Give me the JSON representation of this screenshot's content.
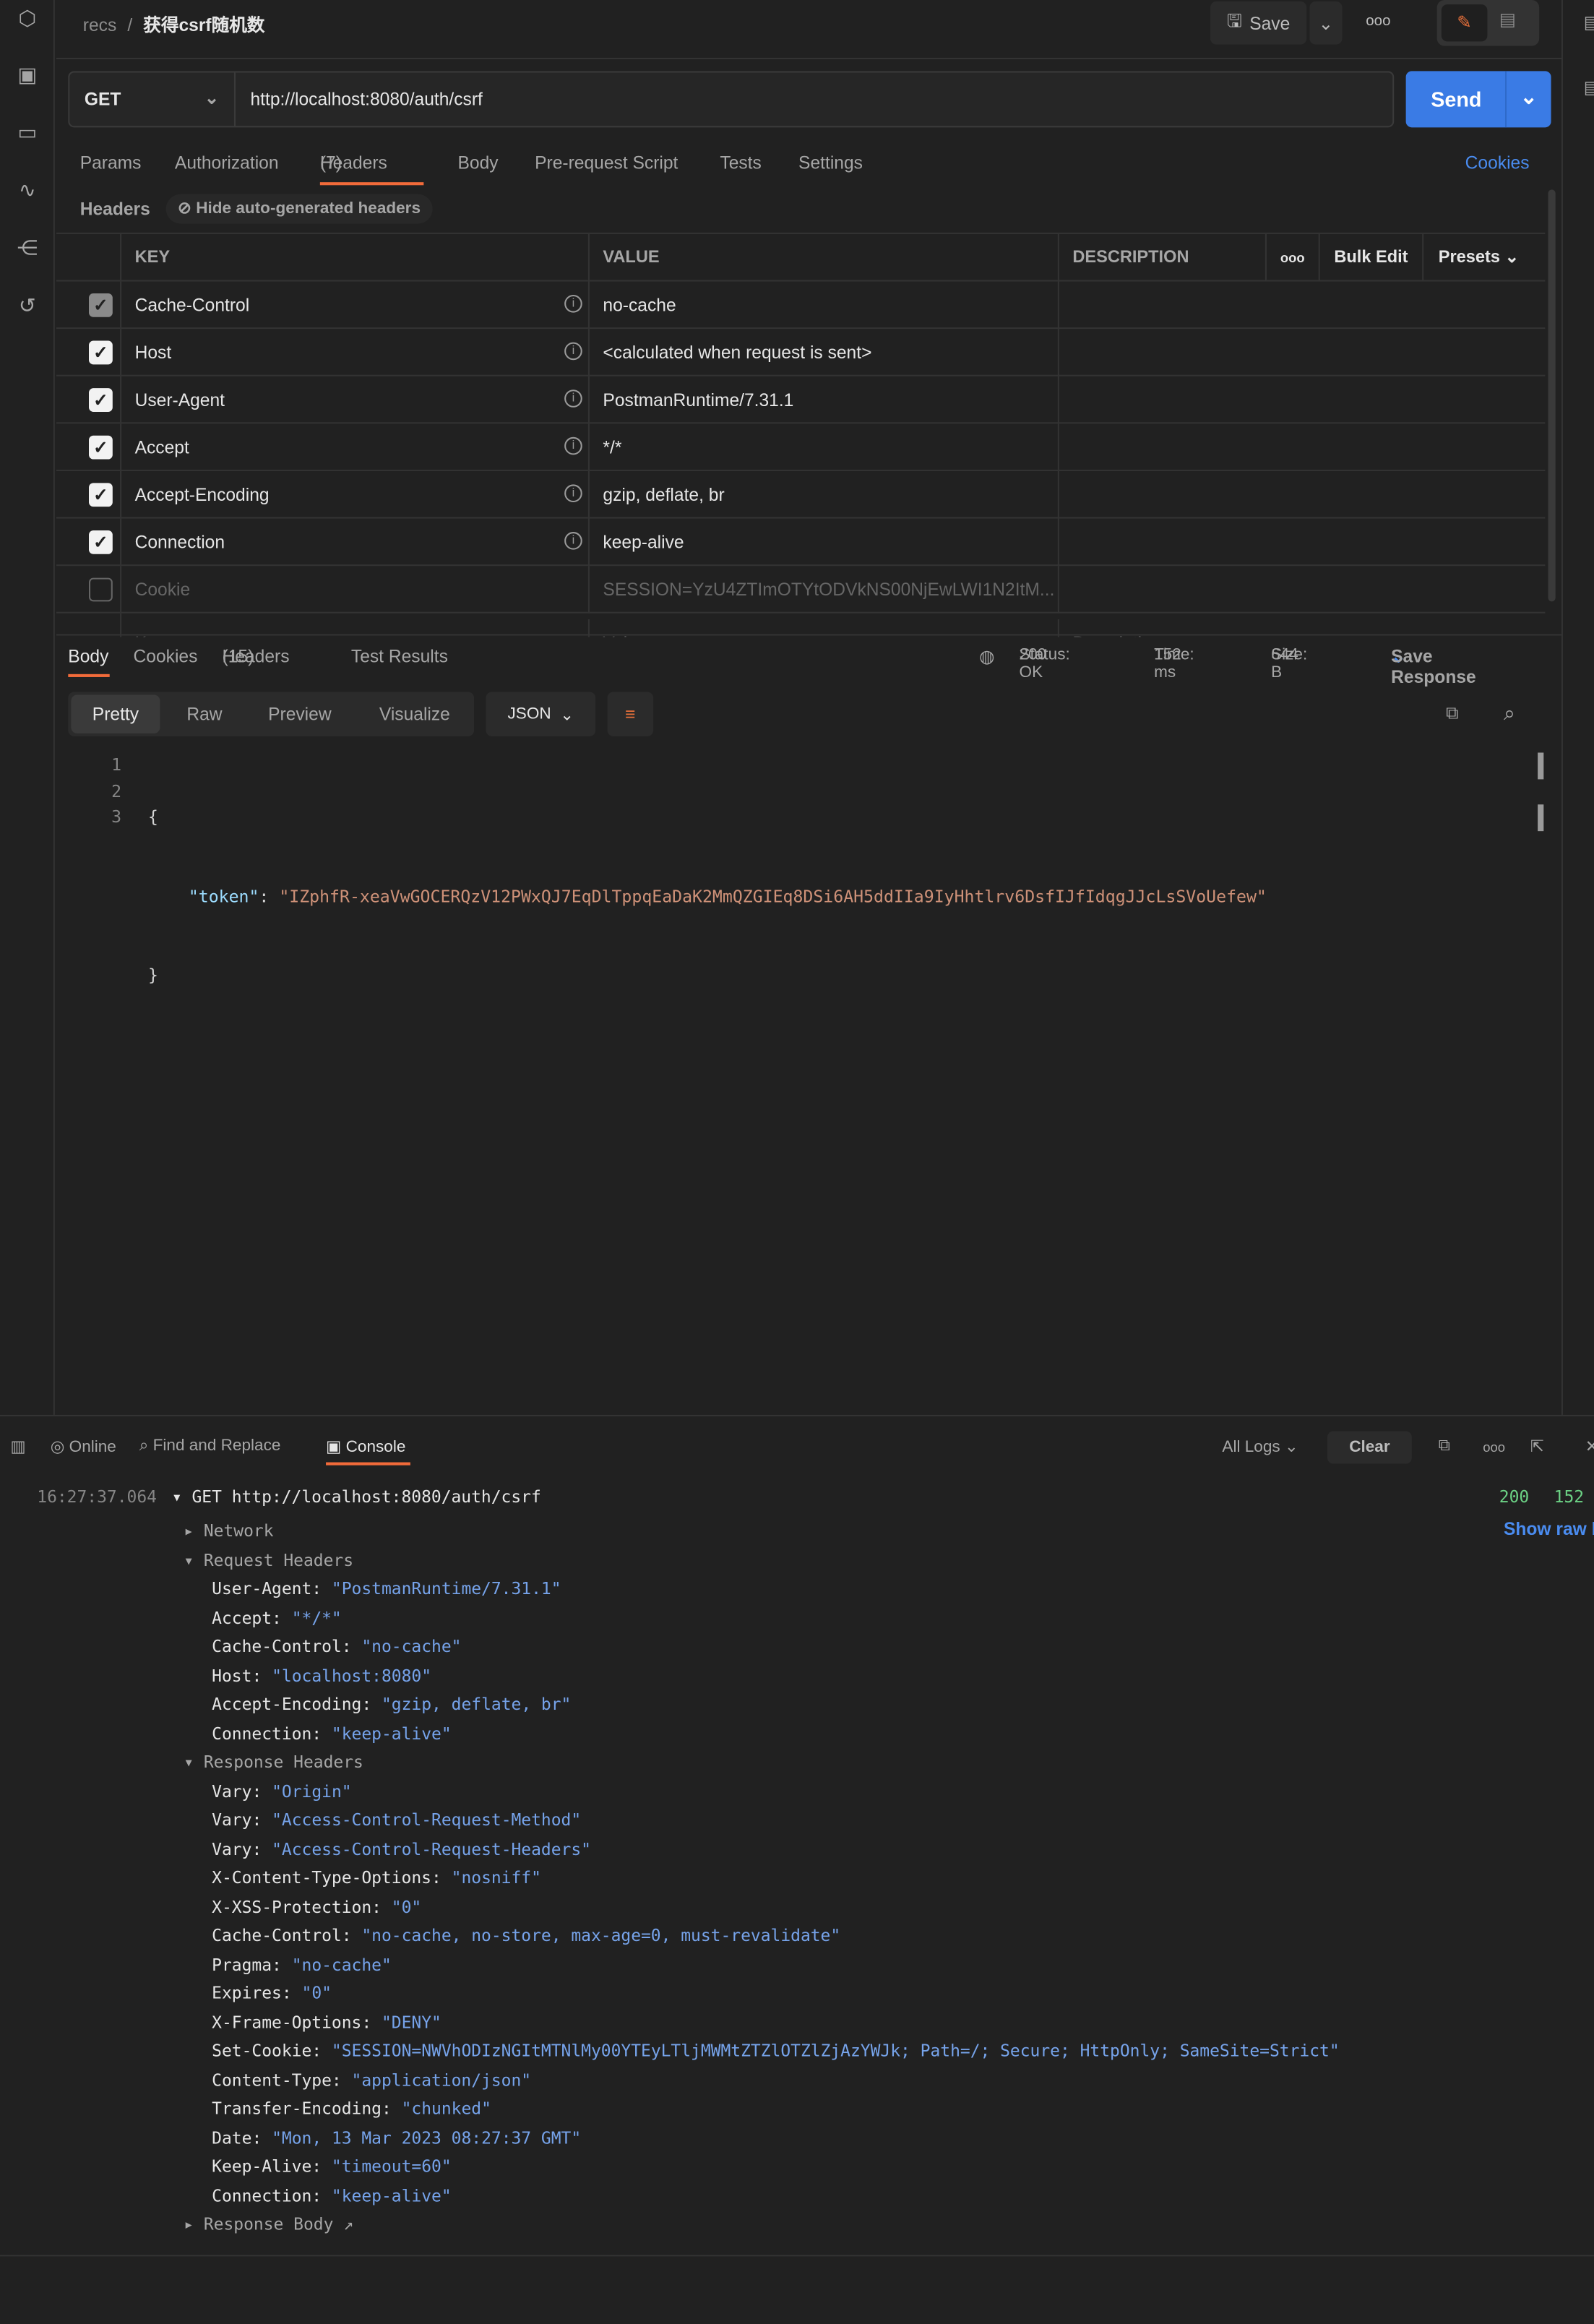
{
  "breadcrumb": {
    "collection": "recs",
    "separator": "/",
    "request": "获得csrf随机数"
  },
  "toolbar": {
    "save": "Save",
    "more": "ooo"
  },
  "request": {
    "method": "GET",
    "url": "http://localhost:8080/auth/csrf",
    "send": "Send"
  },
  "tabs": [
    {
      "label": "Params"
    },
    {
      "label": "Authorization"
    },
    {
      "label": "Headers",
      "count": "(7)"
    },
    {
      "label": "Body"
    },
    {
      "label": "Pre-request Script"
    },
    {
      "label": "Tests"
    },
    {
      "label": "Settings"
    }
  ],
  "cookies_link": "Cookies",
  "headers_section": {
    "title": "Headers",
    "hide_auto": "Hide auto-generated headers"
  },
  "table": {
    "columns": [
      "KEY",
      "VALUE",
      "DESCRIPTION"
    ],
    "bulk_edit": "Bulk Edit",
    "presets": "Presets",
    "more": "ooo",
    "rows": [
      {
        "key": "Cache-Control",
        "value": "no-cache",
        "checked": "disabled"
      },
      {
        "key": "Host",
        "value": "<calculated when request is sent>",
        "checked": true
      },
      {
        "key": "User-Agent",
        "value": "PostmanRuntime/7.31.1",
        "checked": true
      },
      {
        "key": "Accept",
        "value": "*/*",
        "checked": true
      },
      {
        "key": "Accept-Encoding",
        "value": "gzip, deflate, br",
        "checked": true
      },
      {
        "key": "Connection",
        "value": "keep-alive",
        "checked": true
      },
      {
        "key": "Cookie",
        "value": "SESSION=YzU4ZTImOTYtODVkNS00NjEwLWI1N2ItM...",
        "checked": false
      }
    ],
    "placeholder": {
      "key": "Key",
      "value": "Value",
      "description": "Description"
    }
  },
  "response": {
    "tabs": [
      "Body",
      "Cookies",
      "Headers",
      "Test Results"
    ],
    "headers_count": "(15)",
    "status_label": "Status:",
    "status": "200 OK",
    "time_label": "Time:",
    "time": "152 ms",
    "size_label": "Size:",
    "size": "644 B",
    "save": "Save Response",
    "views": [
      "Pretty",
      "Raw",
      "Preview",
      "Visualize"
    ],
    "format": "JSON",
    "lines": [
      "1",
      "2",
      "3"
    ],
    "open": "{",
    "key": "\"token\"",
    "colon": ": ",
    "value": "\"IZphfR-xeaVwGOCERQzV12PWxQJ7EqDlTppqEaDaK2MmQZGIEq8DSi6AH5ddIIa9IyHhtlrv6DsfIJfIdqgJJcLsSVoUefew\"",
    "close": "}"
  },
  "console_bar": {
    "online": "Online",
    "find": "Find and Replace",
    "console": "Console",
    "all_logs": "All Logs",
    "clear": "Clear"
  },
  "console": {
    "time": "16:27:37.064",
    "request": "GET http://localhost:8080/auth/csrf",
    "status": "200",
    "ms": "152",
    "show_raw": "Show raw l",
    "network": "Network",
    "req_headers_title": "Request Headers",
    "resp_headers_title": "Response Headers",
    "resp_body": "Response Body",
    "req_headers": [
      [
        "User-Agent",
        "\"PostmanRuntime/7.31.1\""
      ],
      [
        "Accept",
        "\"*/*\""
      ],
      [
        "Cache-Control",
        "\"no-cache\""
      ],
      [
        "Host",
        "\"localhost:8080\""
      ],
      [
        "Accept-Encoding",
        "\"gzip, deflate, br\""
      ],
      [
        "Connection",
        "\"keep-alive\""
      ]
    ],
    "resp_headers": [
      [
        "Vary",
        "\"Origin\""
      ],
      [
        "Vary",
        "\"Access-Control-Request-Method\""
      ],
      [
        "Vary",
        "\"Access-Control-Request-Headers\""
      ],
      [
        "X-Content-Type-Options",
        "\"nosniff\""
      ],
      [
        "X-XSS-Protection",
        "\"0\""
      ],
      [
        "Cache-Control",
        "\"no-cache, no-store, max-age=0, must-revalidate\""
      ],
      [
        "Pragma",
        "\"no-cache\""
      ],
      [
        "Expires",
        "\"0\""
      ],
      [
        "X-Frame-Options",
        "\"DENY\""
      ],
      [
        "Set-Cookie",
        "\"SESSION=NWVhODIzNGItMTNlMy00YTEyLTljMWMtZTZlOTZlZjAzYWJk; Path=/; Secure; HttpOnly; SameSite=Strict\""
      ],
      [
        "Content-Type",
        "\"application/json\""
      ],
      [
        "Transfer-Encoding",
        "\"chunked\""
      ],
      [
        "Date",
        "\"Mon, 13 Mar 2023 08:27:37 GMT\""
      ],
      [
        "Keep-Alive",
        "\"timeout=60\""
      ],
      [
        "Connection",
        "\"keep-alive\""
      ]
    ]
  },
  "colors": {
    "accent": "#3a7be5",
    "tab_underline": "#f26b3a",
    "status_ok": "#6cd285",
    "json_string": "#ce9178",
    "json_key": "#9cdcfe",
    "console_string": "#76a3ea"
  }
}
